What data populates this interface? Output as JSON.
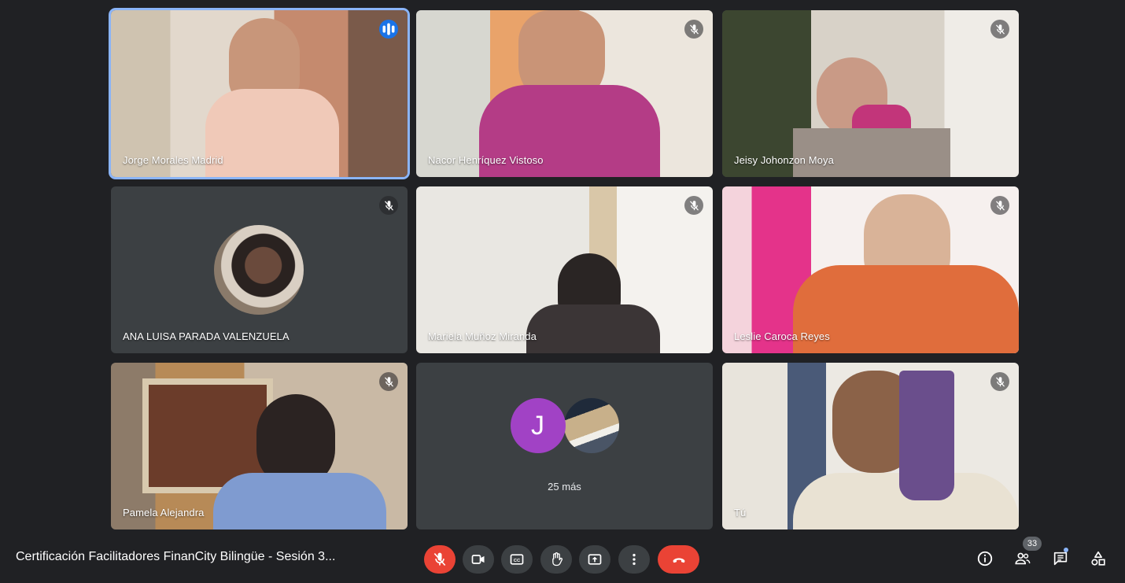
{
  "participants": [
    {
      "name": "Jorge Morales Madrid"
    },
    {
      "name": "Nacor Henríquez Vistoso"
    },
    {
      "name": "Jeisy Johonzon Moya"
    },
    {
      "name": "ANA LUISA PARADA VALENZUELA"
    },
    {
      "name": "Mariela Muñoz Miranda"
    },
    {
      "name": "Leslie Caroca Reyes"
    },
    {
      "name": "Pamela Alejandra"
    },
    {
      "name": "Tú"
    }
  ],
  "more": {
    "avatar_letter": "J",
    "label": "25 más"
  },
  "meeting": {
    "title": "Certificación Facilitadores FinanCity Bilingüe - Sesión 3..."
  },
  "people": {
    "count": "33"
  },
  "colors": {
    "accent": "#8ab4f8",
    "danger": "#ea4335",
    "tile_bg": "#3c4043",
    "page_bg": "#202124",
    "avatar_j": "#a142c5"
  }
}
